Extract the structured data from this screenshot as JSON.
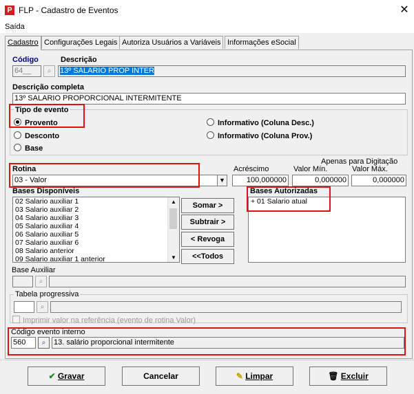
{
  "window": {
    "title": "FLP - Cadastro de Eventos",
    "close_glyph": "✕",
    "app_icon_letter": "P"
  },
  "menu": {
    "saida": "Saída"
  },
  "tabs": [
    "Cadastro",
    "Configurações Legais",
    "Autoriza Usuários a Variáveis",
    "Informações eSocial"
  ],
  "codigo": {
    "label": "Código",
    "value": "64__"
  },
  "descricao": {
    "label": "Descrição",
    "value": "13º SALARIO PROP INTER"
  },
  "descricao_completa": {
    "label": "Descrição completa",
    "value": "13º SALARIO PROPORCIONAL INTERMITENTE"
  },
  "tipo_evento": {
    "label": "Tipo de evento",
    "options": [
      "Provento",
      "Desconto",
      "Base",
      "Informativo (Coluna Desc.)",
      "Informativo (Coluna Prov.)"
    ],
    "selected": "Provento"
  },
  "rotina": {
    "label": "Rotina",
    "value": "03 - Valor"
  },
  "apenas_digitacao": "Apenas para Digitação",
  "acrescimo": {
    "label": "Acréscimo",
    "value": "100,000000"
  },
  "valor_min": {
    "label": "Valor Mín.",
    "value": "0,000000"
  },
  "valor_max": {
    "label": "Valor Máx.",
    "value": "0,000000"
  },
  "bases_disponiveis": {
    "label": "Bases Disponíveis",
    "items": [
      "02 Salario auxiliar 1",
      "03 Salario auxiliar 2",
      "04 Salario auxiliar 3",
      "05 Salario auxiliar 4",
      "06 Salario auxiliar 5",
      "07 Salario auxiliar 6",
      "08 Salario anterior",
      "09 Salario auxiliar 1 anterior"
    ]
  },
  "bases_autorizadas": {
    "label": "Bases Autorizadas",
    "items": [
      "+ 01 Salario atual"
    ]
  },
  "buttons_mid": {
    "somar": "Somar >",
    "subtrair": "Subtrair >",
    "revoga": "< Revoga",
    "todos": "<<Todos"
  },
  "base_auxiliar": {
    "label": "Base Auxiliar"
  },
  "tabela_progressiva": {
    "label": "Tabela progressiva"
  },
  "imprimir_valor": {
    "label": "Imprimir valor na referência (evento de rotina Valor)"
  },
  "codigo_evento_interno": {
    "label": "Código evento interno",
    "value": "560",
    "descricao": "13. salário proporcional intermitente"
  },
  "bottom_buttons": {
    "gravar": "Gravar",
    "cancelar": "Cancelar",
    "limpar": "Limpar",
    "excluir": "Excluir"
  },
  "colors": {
    "highlight_red": "#e01010",
    "selection_blue": "#0078d7",
    "app_red": "#d11f1f"
  }
}
